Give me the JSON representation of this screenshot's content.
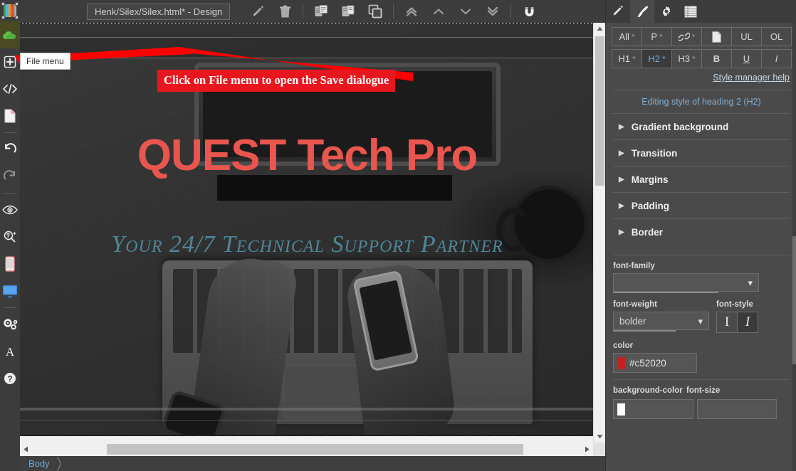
{
  "app": {
    "title_field": "Henk/Silex/Silex.html* - Design"
  },
  "left_rail": {
    "items": [
      {
        "name": "logo",
        "label": "Silex logo"
      },
      {
        "name": "publish-cloud",
        "label": "File menu"
      },
      {
        "name": "add-element",
        "label": "Add element"
      },
      {
        "name": "html-box",
        "label": "HTML box"
      },
      {
        "name": "new-page",
        "label": "New page"
      },
      {
        "name": "undo",
        "label": "Undo"
      },
      {
        "name": "redo",
        "label": "Redo"
      },
      {
        "name": "preview",
        "label": "Preview"
      },
      {
        "name": "responsive",
        "label": "Responsive"
      },
      {
        "name": "mobile-view",
        "label": "Mobile view"
      },
      {
        "name": "desktop-view",
        "label": "Desktop view"
      },
      {
        "name": "settings",
        "label": "Settings"
      },
      {
        "name": "fonts",
        "label": "Fonts"
      },
      {
        "name": "help",
        "label": "Help"
      }
    ]
  },
  "toolbar": {
    "buttons": [
      {
        "name": "edit-pencil",
        "label": "Edit"
      },
      {
        "name": "delete-trash",
        "label": "Delete"
      },
      {
        "name": "paste-clipboard",
        "label": "Paste"
      },
      {
        "name": "copy-clipboard",
        "label": "Copy"
      },
      {
        "name": "duplicate",
        "label": "Duplicate"
      },
      {
        "name": "move-to-top",
        "label": "Move to top"
      },
      {
        "name": "move-up",
        "label": "Move up"
      },
      {
        "name": "move-down",
        "label": "Move down"
      },
      {
        "name": "move-to-bottom",
        "label": "Move to bottom"
      },
      {
        "name": "magnet-snap",
        "label": "Snap to grid"
      }
    ]
  },
  "tooltip": {
    "text": "File menu"
  },
  "callout": {
    "banner": "Click on File menu to open the Save dialogue"
  },
  "canvas": {
    "hero_title": "QUEST Tech Pro",
    "hero_subtitle": "Your 24/7 Technical  Support Partner"
  },
  "breadcrumb": {
    "items": [
      "Body"
    ]
  },
  "right_panel": {
    "tabs": [
      {
        "name": "tab-properties",
        "icon": "pencil-icon",
        "active": false
      },
      {
        "name": "tab-style",
        "icon": "paintbrush-icon",
        "active": true
      },
      {
        "name": "tab-settings",
        "icon": "gear-icon",
        "active": false
      },
      {
        "name": "tab-list",
        "icon": "list-icon",
        "active": false
      }
    ],
    "selector_row_1": [
      {
        "label": "All",
        "star": "*",
        "selected": false
      },
      {
        "label": "P",
        "star": "*",
        "selected": false
      },
      {
        "label": "link",
        "star": "*",
        "selected": false,
        "icon": "link-icon"
      },
      {
        "label": "page",
        "star": "",
        "selected": false,
        "icon": "page-icon"
      },
      {
        "label": "UL",
        "star": "",
        "selected": false
      },
      {
        "label": "OL",
        "star": "",
        "selected": false
      }
    ],
    "selector_row_2": [
      {
        "label": "H1",
        "star": "*",
        "selected": false
      },
      {
        "label": "H2",
        "star": "*",
        "selected": true
      },
      {
        "label": "H3",
        "star": "*",
        "selected": false
      },
      {
        "label": "B",
        "star": "",
        "selected": false
      },
      {
        "label": "U",
        "star": "",
        "selected": false
      },
      {
        "label": "I",
        "star": "",
        "selected": false
      }
    ],
    "help_link": "Style manager help",
    "editing_label": "Editing style of heading 2 (H2)",
    "accordions": [
      {
        "label": "Gradient background"
      },
      {
        "label": "Transition"
      },
      {
        "label": "Margins"
      },
      {
        "label": "Padding"
      },
      {
        "label": "Border"
      }
    ],
    "properties": {
      "font_family_label": "font-family",
      "font_family_value": "",
      "font_weight_label": "font-weight",
      "font_weight_value": "bolder",
      "font_style_label": "font-style",
      "color_label": "color",
      "color_value": "#c52020",
      "background_color_label": "background-color",
      "font_size_label": "font-size"
    }
  },
  "colors": {
    "accent_red": "#c52020",
    "hero_red": "#e8564e",
    "hero_teal": "#4e8799",
    "link_blue": "#6fa8d6",
    "callout_red": "#e8171f"
  }
}
